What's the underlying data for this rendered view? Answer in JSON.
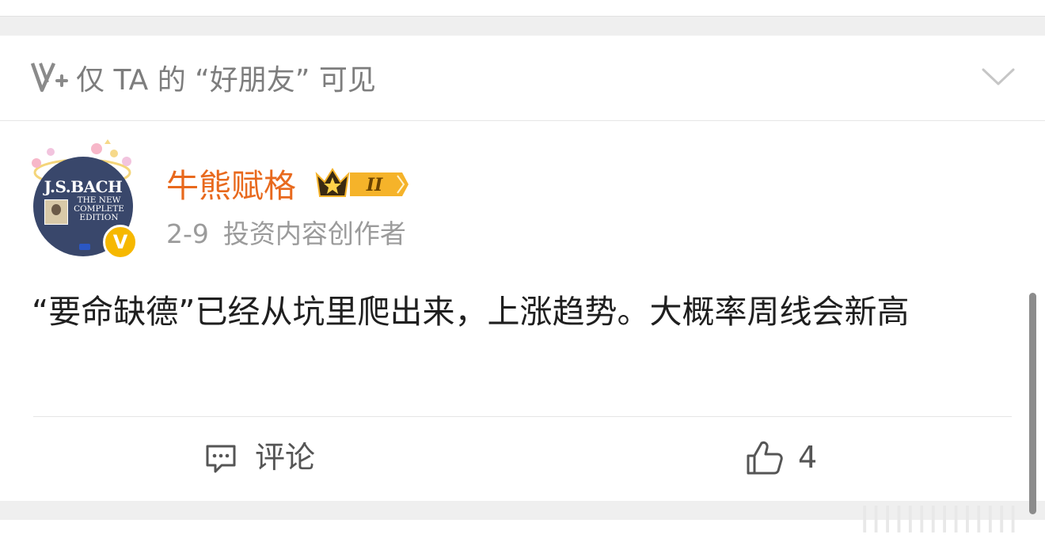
{
  "visibility": {
    "icon": "visibility-v-plus-icon",
    "text": "仅 TA 的 “好朋友” 可见",
    "chevron_icon": "chevron-down-icon"
  },
  "post": {
    "avatar": {
      "album_title": "J.S.BACH",
      "album_subtitle": "THE NEW COMPLETE EDITION"
    },
    "username": "牛熊赋格",
    "vip_level": "II",
    "verified_badge": "V",
    "date": "2-9",
    "role": "投资内容创作者",
    "text": "“要命缺德”已经从坑里爬出来，上涨趋势。大概率周线会新高",
    "actions": {
      "comment_label": "评论",
      "like_count": "4"
    }
  },
  "colors": {
    "username": "#e8691d",
    "meta": "#9b9b9b",
    "text": "#1f1f1f",
    "band": "#efefef",
    "verified": "#f6b800"
  },
  "watermark": "||||||||||||||"
}
